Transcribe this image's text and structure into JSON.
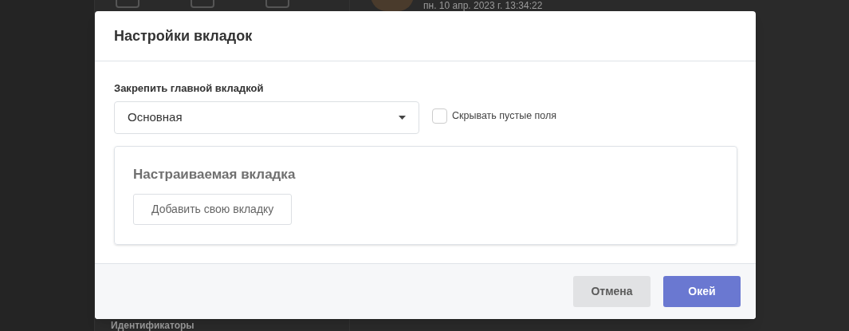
{
  "background": {
    "timestamp": "пн. 10 апр. 2023 г. 13:34:22",
    "section_link": "Идентификаторы"
  },
  "dialog": {
    "title": "Настройки вкладок",
    "main_tab_label": "Закрепить главной вкладкой",
    "main_tab_select": {
      "value": "Основная"
    },
    "hide_empty": {
      "label": "Скрывать пустые поля",
      "checked": false
    },
    "custom_tab": {
      "title": "Настраиваемая вкладка",
      "add_button": "Добавить свою вкладку"
    },
    "buttons": [
      {
        "label": "Отмена",
        "kind": "secondary"
      },
      {
        "label": "Окей",
        "kind": "primary"
      }
    ]
  }
}
